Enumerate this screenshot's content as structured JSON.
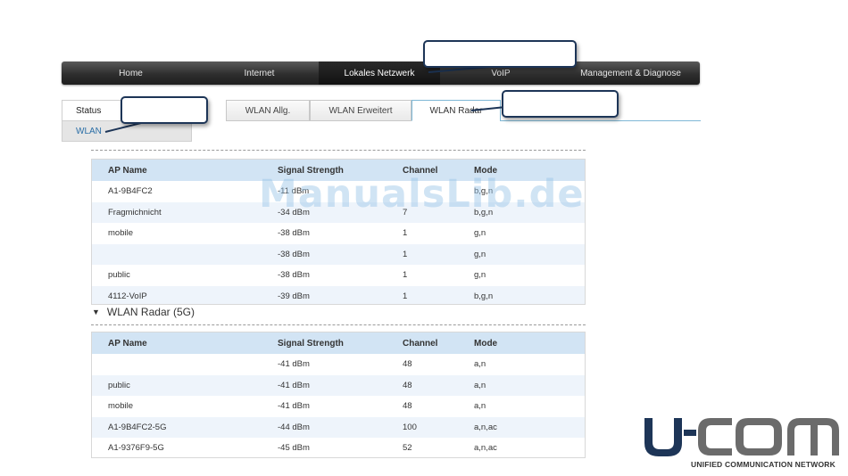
{
  "nav": {
    "items": [
      {
        "label": "Home",
        "active": false
      },
      {
        "label": "Internet",
        "active": false
      },
      {
        "label": "Lokales Netzwerk",
        "active": true
      },
      {
        "label": "VoIP",
        "active": false
      },
      {
        "label": "Management & Diagnose",
        "active": false
      }
    ]
  },
  "sidebar": {
    "items": [
      {
        "label": "Status"
      },
      {
        "label": "WLAN",
        "active": true
      }
    ]
  },
  "subtabs": [
    {
      "label": "WLAN Allg."
    },
    {
      "label": "WLAN Erweitert"
    },
    {
      "label": "WLAN Radar",
      "active": true
    }
  ],
  "table24": {
    "headers": [
      "AP Name",
      "Signal Strength",
      "Channel",
      "Mode"
    ],
    "rows": [
      [
        "A1-9B4FC2",
        "-11 dBm",
        "",
        "b,g,n"
      ],
      [
        "Fragmichnicht",
        "-34 dBm",
        "7",
        "b,g,n"
      ],
      [
        "mobile",
        "-38 dBm",
        "1",
        "g,n"
      ],
      [
        "",
        "-38 dBm",
        "1",
        "g,n"
      ],
      [
        "public",
        "-38 dBm",
        "1",
        "g,n"
      ],
      [
        "4112-VoIP",
        "-39 dBm",
        "1",
        "b,g,n"
      ]
    ]
  },
  "section5g": {
    "title": "WLAN Radar (5G)"
  },
  "table5g": {
    "headers": [
      "AP Name",
      "Signal Strength",
      "Channel",
      "Mode"
    ],
    "rows": [
      [
        "",
        "-41 dBm",
        "48",
        "a,n"
      ],
      [
        "public",
        "-41 dBm",
        "48",
        "a,n"
      ],
      [
        "mobile",
        "-41 dBm",
        "48",
        "a,n"
      ],
      [
        "A1-9B4FC2-5G",
        "-44 dBm",
        "100",
        "a,n,ac"
      ],
      [
        "A1-9376F9-5G",
        "-45 dBm",
        "52",
        "a,n,ac"
      ]
    ]
  },
  "watermark": "ManualsLib.de",
  "logo": {
    "text": "UCOM",
    "tagline": "UNIFIED COMMUNICATION NETWORK",
    "color_dark": "#1d3557",
    "color_gray": "#666666"
  }
}
